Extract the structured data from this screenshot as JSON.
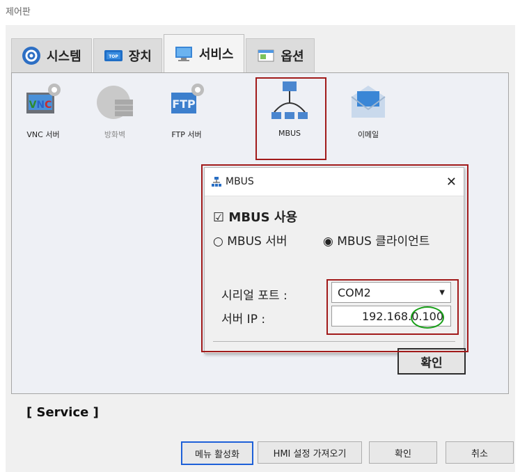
{
  "window": {
    "title": "제어판"
  },
  "tabs": [
    {
      "label": "시스템"
    },
    {
      "label": "장치"
    },
    {
      "label": "서비스"
    },
    {
      "label": "옵션"
    }
  ],
  "services": [
    {
      "label": "VNC 서버",
      "icon": "vnc-icon"
    },
    {
      "label": "방화벽",
      "icon": "firewall-globe-icon"
    },
    {
      "label": "FTP 서버",
      "icon": "ftp-icon"
    },
    {
      "label": "MBUS",
      "icon": "mbus-network-icon"
    },
    {
      "label": "이메일",
      "icon": "email-envelope-icon"
    }
  ],
  "dialog": {
    "title": "MBUS",
    "enable_label": "MBUS 사용",
    "mode_server_label": "MBUS 서버",
    "mode_client_label": "MBUS 클라이언트",
    "serial_port_label": "시리얼 포트 :",
    "serial_port_value": "COM2",
    "server_ip_label": "서버 IP   :",
    "server_ip_value": "192.168.0.100",
    "ok_label": "확인"
  },
  "status": {
    "text": "[ Service ]"
  },
  "bottom_buttons": {
    "activate_menu": "메뉴 활성화",
    "import_hmi": "HMI 설정 가져오기",
    "ok": "확인",
    "cancel": "취소"
  },
  "colors": {
    "highlight_red": "#a11a1a",
    "highlight_green": "#1aa01a",
    "focus_blue": "#1d60d8"
  }
}
